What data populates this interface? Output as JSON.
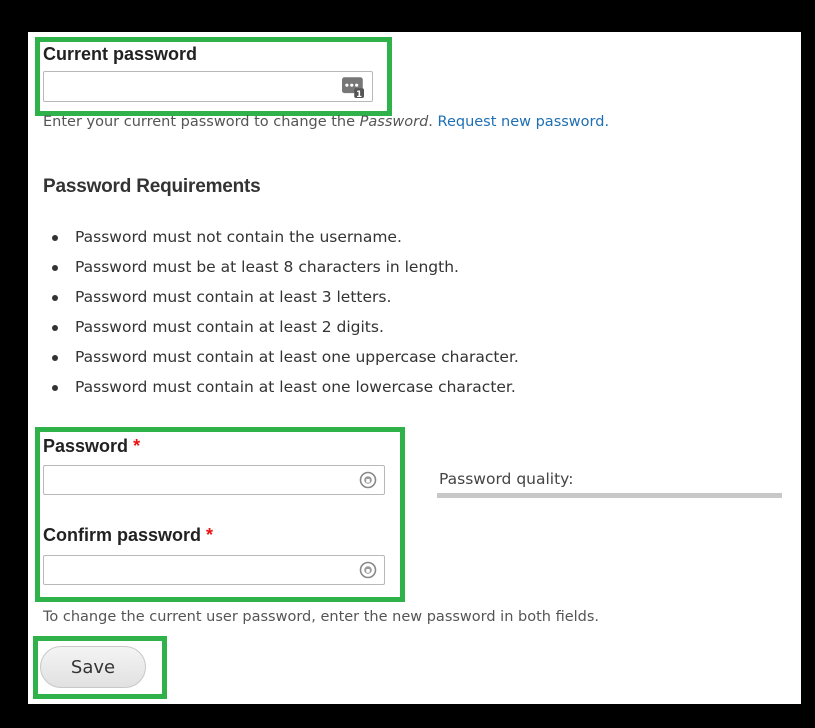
{
  "current_password": {
    "label": "Current password",
    "value": "",
    "description_prefix": "Enter your current password to change the ",
    "description_emphasis": "Password",
    "description_suffix": ". ",
    "request_link": "Request new password."
  },
  "requirements": {
    "heading": "Password Requirements",
    "items": [
      "Password must not contain the username.",
      "Password must be at least 8 characters in length.",
      "Password must contain at least 3 letters.",
      "Password must contain at least 2 digits.",
      "Password must contain at least one uppercase character.",
      "Password must contain at least one lowercase character."
    ]
  },
  "password": {
    "label": "Password",
    "required_marker": "*",
    "value": "",
    "quality_label": "Password quality:"
  },
  "confirm_password": {
    "label": "Confirm password",
    "required_marker": "*",
    "value": ""
  },
  "change_help": "To change the current user password, enter the new password in both fields.",
  "save_button": "Save",
  "colors": {
    "highlight": "#2fb24a",
    "link": "#1e6fb3",
    "required": "#ee1111"
  },
  "icons": {
    "current_password_field": "password-manager-icon",
    "password_field": "password-reveal-icon",
    "confirm_password_field": "password-reveal-icon"
  }
}
